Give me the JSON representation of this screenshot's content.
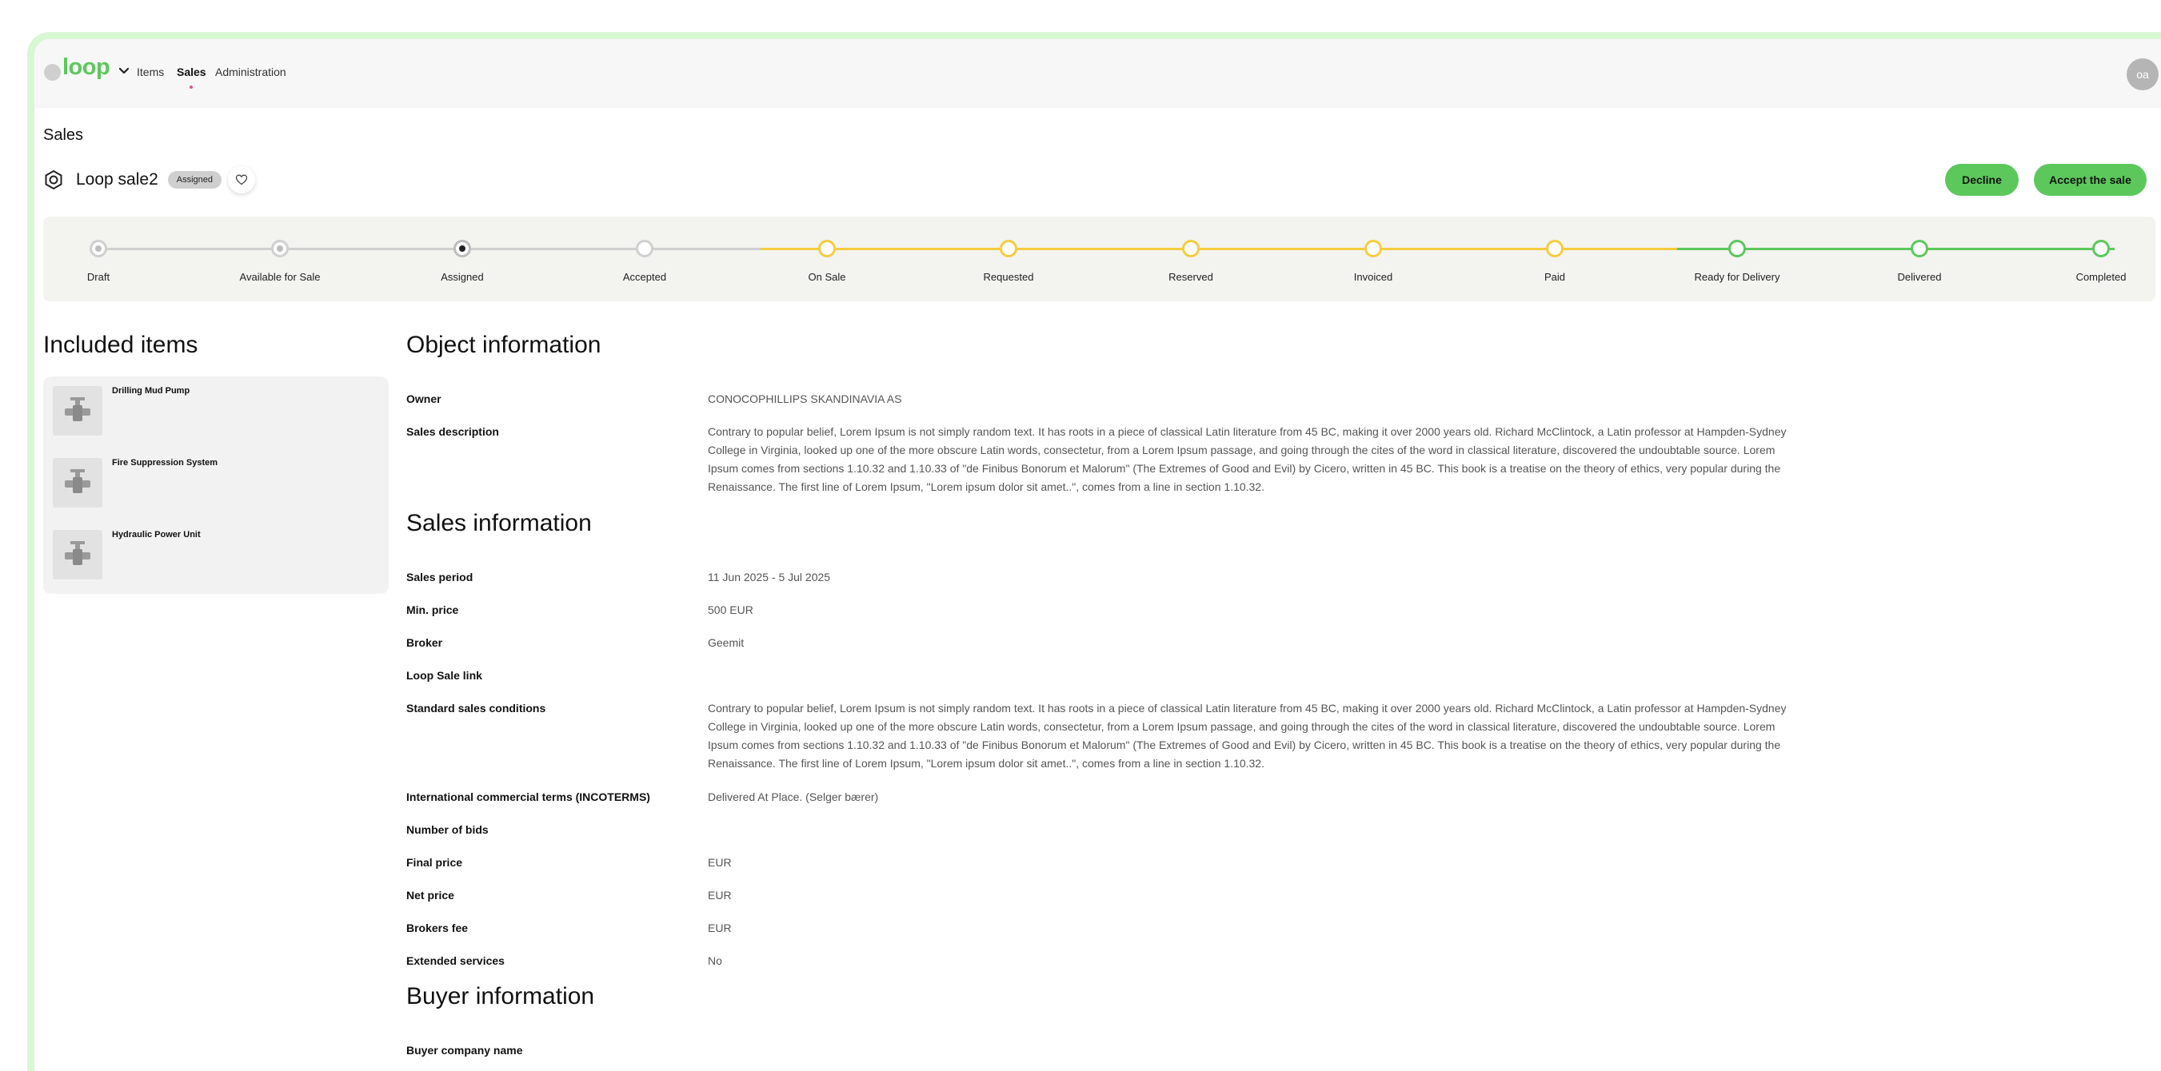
{
  "header": {
    "logo": "loop",
    "nav": {
      "items": "Items",
      "sales": "Sales",
      "administration": "Administration"
    },
    "avatar_initials": "oa"
  },
  "breadcrumb": "Sales",
  "sale": {
    "title": "Loop sale2",
    "status": "Assigned",
    "actions": {
      "decline": "Decline",
      "accept": "Accept the sale"
    }
  },
  "stepper": {
    "current": "Assigned",
    "steps": [
      {
        "label": "Draft",
        "state": "done"
      },
      {
        "label": "Available for Sale",
        "state": "done"
      },
      {
        "label": "Assigned",
        "state": "current"
      },
      {
        "label": "Accepted",
        "state": "upcoming"
      },
      {
        "label": "On Sale",
        "state": "upcoming"
      },
      {
        "label": "Requested",
        "state": "upcoming"
      },
      {
        "label": "Reserved",
        "state": "upcoming"
      },
      {
        "label": "Invoiced",
        "state": "upcoming"
      },
      {
        "label": "Paid",
        "state": "upcoming"
      },
      {
        "label": "Ready for Delivery",
        "state": "upcoming"
      },
      {
        "label": "Delivered",
        "state": "upcoming"
      },
      {
        "label": "Completed",
        "state": "upcoming"
      }
    ],
    "colors": {
      "gray": "#cfcfcf",
      "yellow": "#f5cc3e",
      "green": "#5cc85c"
    }
  },
  "included_items": {
    "title": "Included items",
    "items": [
      {
        "name": "Drilling Mud Pump",
        "icon": "valve-icon"
      },
      {
        "name": "Fire Suppression System",
        "icon": "valve-icon"
      },
      {
        "name": "Hydraulic Power Unit",
        "icon": "valve-icon"
      }
    ]
  },
  "object_information": {
    "title": "Object information",
    "owner_label": "Owner",
    "owner": "CONOCOPHILLIPS SKANDINAVIA AS",
    "description_label": "Sales description",
    "description": "Contrary to popular belief, Lorem Ipsum is not simply random text. It has roots in a piece of classical Latin literature from 45 BC, making it over 2000 years old. Richard McClintock, a Latin professor at Hampden-Sydney College in Virginia, looked up one of the more obscure Latin words, consectetur, from a Lorem Ipsum passage, and going through the cites of the word in classical literature, discovered the undoubtable source. Lorem Ipsum comes from sections 1.10.32 and 1.10.33 of \"de Finibus Bonorum et Malorum\" (The Extremes of Good and Evil) by Cicero, written in 45 BC. This book is a treatise on the theory of ethics, very popular during the Renaissance. The first line of Lorem Ipsum, \"Lorem ipsum dolor sit amet..\", comes from a line in section 1.10.32."
  },
  "sales_information": {
    "title": "Sales information",
    "period_label": "Sales period",
    "period": "11 Jun 2025 - 5 Jul 2025",
    "min_price_label": "Min. price",
    "min_price": "500 EUR",
    "broker_label": "Broker",
    "broker": "Geemit",
    "link_label": "Loop Sale link",
    "link": "",
    "conditions_label": "Standard sales conditions",
    "conditions": "Contrary to popular belief, Lorem Ipsum is not simply random text. It has roots in a piece of classical Latin literature from 45 BC, making it over 2000 years old. Richard McClintock, a Latin professor at Hampden-Sydney College in Virginia, looked up one of the more obscure Latin words, consectetur, from a Lorem Ipsum passage, and going through the cites of the word in classical literature, discovered the undoubtable source. Lorem Ipsum comes from sections 1.10.32 and 1.10.33 of \"de Finibus Bonorum et Malorum\" (The Extremes of Good and Evil) by Cicero, written in 45 BC. This book is a treatise on the theory of ethics, very popular during the Renaissance. The first line of Lorem Ipsum, \"Lorem ipsum dolor sit amet..\", comes from a line in section 1.10.32.",
    "incoterms_label": "International commercial terms (INCOTERMS)",
    "incoterms": "Delivered At Place. (Selger bærer)",
    "bids_label": "Number of bids",
    "bids": "",
    "final_price_label": "Final price",
    "final_price": "EUR",
    "net_price_label": "Net price",
    "net_price": "EUR",
    "brokers_fee_label": "Brokers fee",
    "brokers_fee": "EUR",
    "extended_label": "Extended services",
    "extended": "No"
  },
  "buyer_information": {
    "title": "Buyer information",
    "company_label": "Buyer company name"
  }
}
